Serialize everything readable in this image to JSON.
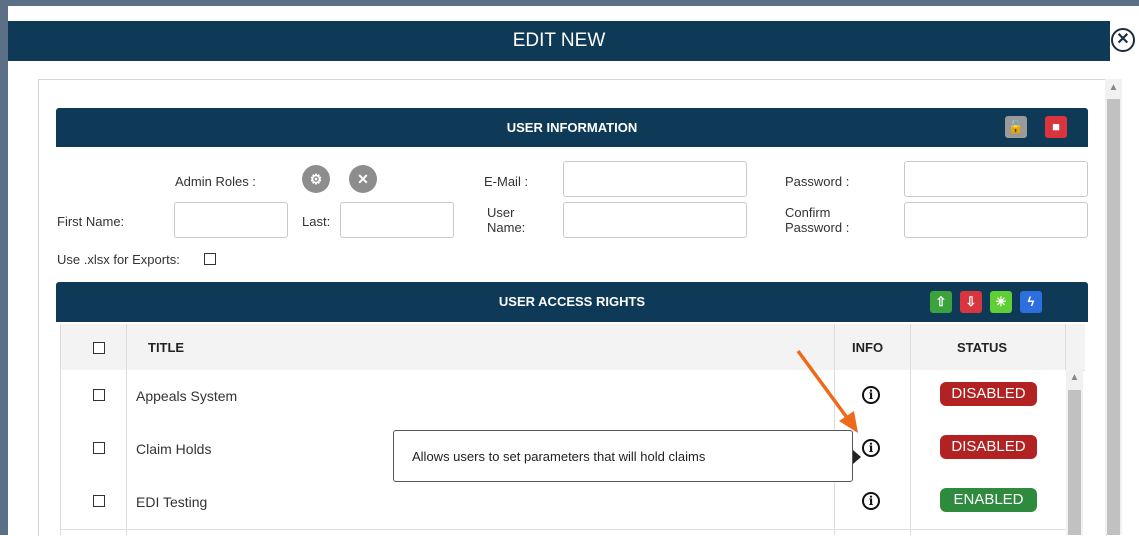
{
  "modal": {
    "title": "EDIT NEW",
    "close_glyph": "✕"
  },
  "user_info": {
    "header": "USER INFORMATION",
    "admin_roles_label": "Admin Roles :",
    "email_label": "E-Mail :",
    "password_label": "Password :",
    "first_name_label": "First Name:",
    "last_label": "Last:",
    "user_name_label_1": "User",
    "user_name_label_2": "Name:",
    "confirm_label_1": "Confirm",
    "confirm_label_2": "Password :",
    "xlsx_label": "Use .xlsx for Exports:",
    "first_name_value": "",
    "last_value": "",
    "email_value": "",
    "user_name_value": "",
    "password_value": "",
    "confirm_password_value": "",
    "icons": [
      "unlock-icon",
      "save-icon",
      "admin-role-icon",
      "tools-icon"
    ]
  },
  "access_rights": {
    "header": "USER ACCESS RIGHTS",
    "columns": {
      "title": "TITLE",
      "info": "INFO",
      "status": "STATUS"
    },
    "rows": [
      {
        "title": "Appeals System",
        "status": "DISABLED"
      },
      {
        "title": "Claim Holds",
        "status": "DISABLED"
      },
      {
        "title": "EDI Testing",
        "status": "ENABLED"
      }
    ],
    "icons": [
      "upload-icon",
      "download-icon",
      "magic-wand-icon",
      "lightning-icon"
    ]
  },
  "tooltip": {
    "text": "Allows users to set parameters that will hold claims"
  },
  "colors": {
    "header_bg": "#0f3a57",
    "disabled": "#b22222",
    "enabled": "#2e8b3e",
    "annotation_arrow": "#ee6a1a"
  }
}
